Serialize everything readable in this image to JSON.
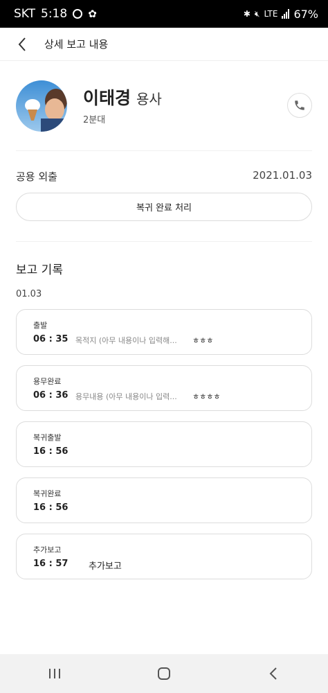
{
  "status_bar": {
    "carrier": "SKT",
    "time": "5:18",
    "network": "LTE",
    "battery": "67%"
  },
  "header": {
    "title": "상세 보고 내용",
    "back_icon": "back-arrow-icon"
  },
  "profile": {
    "name": "이태경",
    "rank": "용사",
    "unit": "2분대",
    "call_icon": "phone-icon"
  },
  "outing": {
    "type": "공용 외출",
    "date": "2021.01.03",
    "return_button_label": "복귀 완료 처리"
  },
  "report_log": {
    "title": "보고 기록",
    "date": "01.03",
    "records": [
      {
        "label": "출발",
        "time": "06 : 35",
        "desc": "목적지 (아무 내용이나 입력해...",
        "note": "ㅎㅎㅎ"
      },
      {
        "label": "용무완료",
        "time": "06 : 36",
        "desc": "용무내용 (아무 내용이나 입력...",
        "note": "ㅎㅎㅎㅎ"
      },
      {
        "label": "복귀출발",
        "time": "16 : 56"
      },
      {
        "label": "복귀완료",
        "time": "16 : 56"
      },
      {
        "label": "추가보고",
        "time": "16 : 57",
        "text": "추가보고"
      }
    ]
  },
  "nav_bar": {
    "items": [
      "recent-apps-icon",
      "home-icon",
      "back-icon"
    ]
  }
}
